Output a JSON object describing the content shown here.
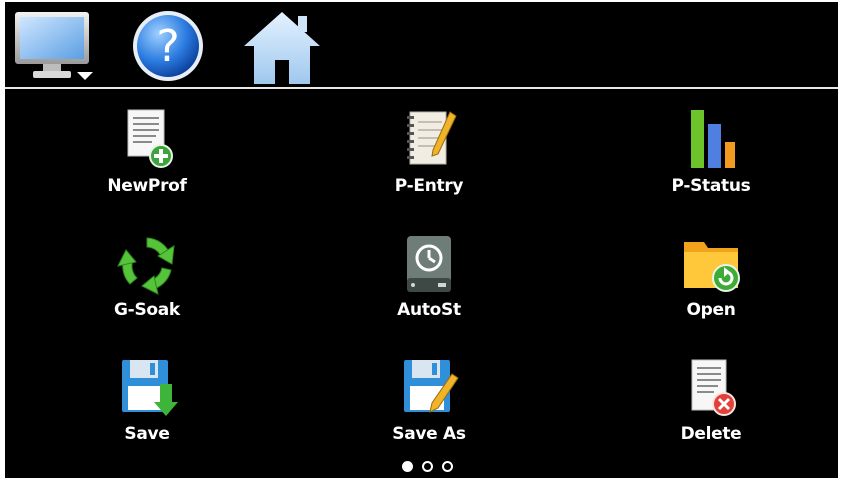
{
  "toolbar": {
    "items": [
      {
        "name": "monitor-menu-button",
        "icon": "monitor-icon"
      },
      {
        "name": "help-button",
        "icon": "help-icon"
      },
      {
        "name": "home-button",
        "icon": "home-icon"
      }
    ]
  },
  "menu": {
    "tiles": [
      {
        "label": "NewProf",
        "icon": "new-profile-icon"
      },
      {
        "label": "P-Entry",
        "icon": "notepad-pencil-icon"
      },
      {
        "label": "P-Status",
        "icon": "bar-chart-icon"
      },
      {
        "label": "G-Soak",
        "icon": "recycle-arrows-icon"
      },
      {
        "label": "AutoSt",
        "icon": "clock-drive-icon"
      },
      {
        "label": "Open",
        "icon": "folder-open-icon"
      },
      {
        "label": "Save",
        "icon": "floppy-disk-icon"
      },
      {
        "label": "Save As",
        "icon": "floppy-pencil-icon"
      },
      {
        "label": "Delete",
        "icon": "delete-document-icon"
      }
    ]
  },
  "pager": {
    "pages": 3,
    "current": 1
  },
  "colors": {
    "background": "#000000",
    "divider": "#e8e8e8",
    "text": "#ffffff"
  }
}
